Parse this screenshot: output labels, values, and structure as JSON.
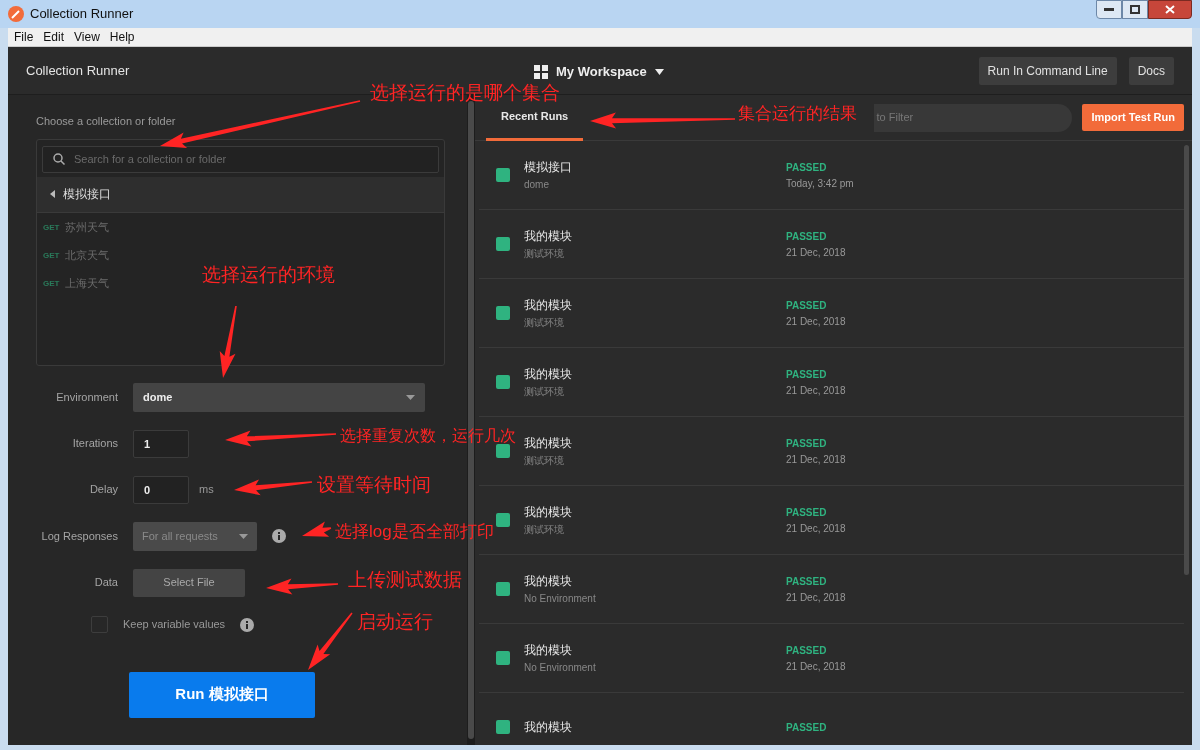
{
  "window": {
    "title": "Collection Runner"
  },
  "menu": [
    "File",
    "Edit",
    "View",
    "Help"
  ],
  "header": {
    "title": "Collection Runner",
    "workspace": "My Workspace",
    "buttons": [
      "Run In Command Line",
      "Docs"
    ]
  },
  "collection_picker": {
    "label": "Choose a collection or folder",
    "search_placeholder": "Search for a collection or folder",
    "collection": {
      "name": "模拟接口",
      "children": [
        {
          "method": "GET",
          "name": "苏州天气"
        },
        {
          "method": "GET",
          "name": "北京天气"
        },
        {
          "method": "GET",
          "name": "上海天气"
        }
      ]
    }
  },
  "form": {
    "environment": {
      "label": "Environment",
      "value": "dome"
    },
    "iterations": {
      "label": "Iterations",
      "value": "1"
    },
    "delay": {
      "label": "Delay",
      "value": "0",
      "unit": "ms"
    },
    "log_responses": {
      "label": "Log Responses",
      "value": "For all requests",
      "disabled": true
    },
    "data": {
      "label": "Data",
      "button": "Select File"
    },
    "keep_variable_values": {
      "label": "Keep variable values",
      "checked": false
    },
    "run_button": "Run 模拟接口"
  },
  "runs_panel": {
    "tabs": [
      {
        "label": "Recent Runs",
        "selected": true
      }
    ],
    "filter_placeholder": "to Filter",
    "import_button": "Import Test Run",
    "runs": [
      {
        "name": "模拟接口",
        "environment": "dome",
        "status": "PASSED",
        "time": "Today, 3:42 pm"
      },
      {
        "name": "我的模块",
        "environment": "测试环境",
        "status": "PASSED",
        "time": "21 Dec, 2018"
      },
      {
        "name": "我的模块",
        "environment": "测试环境",
        "status": "PASSED",
        "time": "21 Dec, 2018"
      },
      {
        "name": "我的模块",
        "environment": "测试环境",
        "status": "PASSED",
        "time": "21 Dec, 2018"
      },
      {
        "name": "我的模块",
        "environment": "测试环境",
        "status": "PASSED",
        "time": "21 Dec, 2018"
      },
      {
        "name": "我的模块",
        "environment": "测试环境",
        "status": "PASSED",
        "time": "21 Dec, 2018"
      },
      {
        "name": "我的模块",
        "environment": "No Environment",
        "status": "PASSED",
        "time": "21 Dec, 2018"
      },
      {
        "name": "我的模块",
        "environment": "No Environment",
        "status": "PASSED",
        "time": "21 Dec, 2018"
      },
      {
        "name": "我的模块",
        "status": "PASSED"
      }
    ]
  },
  "annotations": [
    "选择运行的是哪个集合",
    "集合运行的结果",
    "选择运行的环境",
    "选择重复次数，运行几次",
    "设置等待时间",
    "选择log是否全部打印",
    "上传测试数据",
    "启动运行"
  ]
}
